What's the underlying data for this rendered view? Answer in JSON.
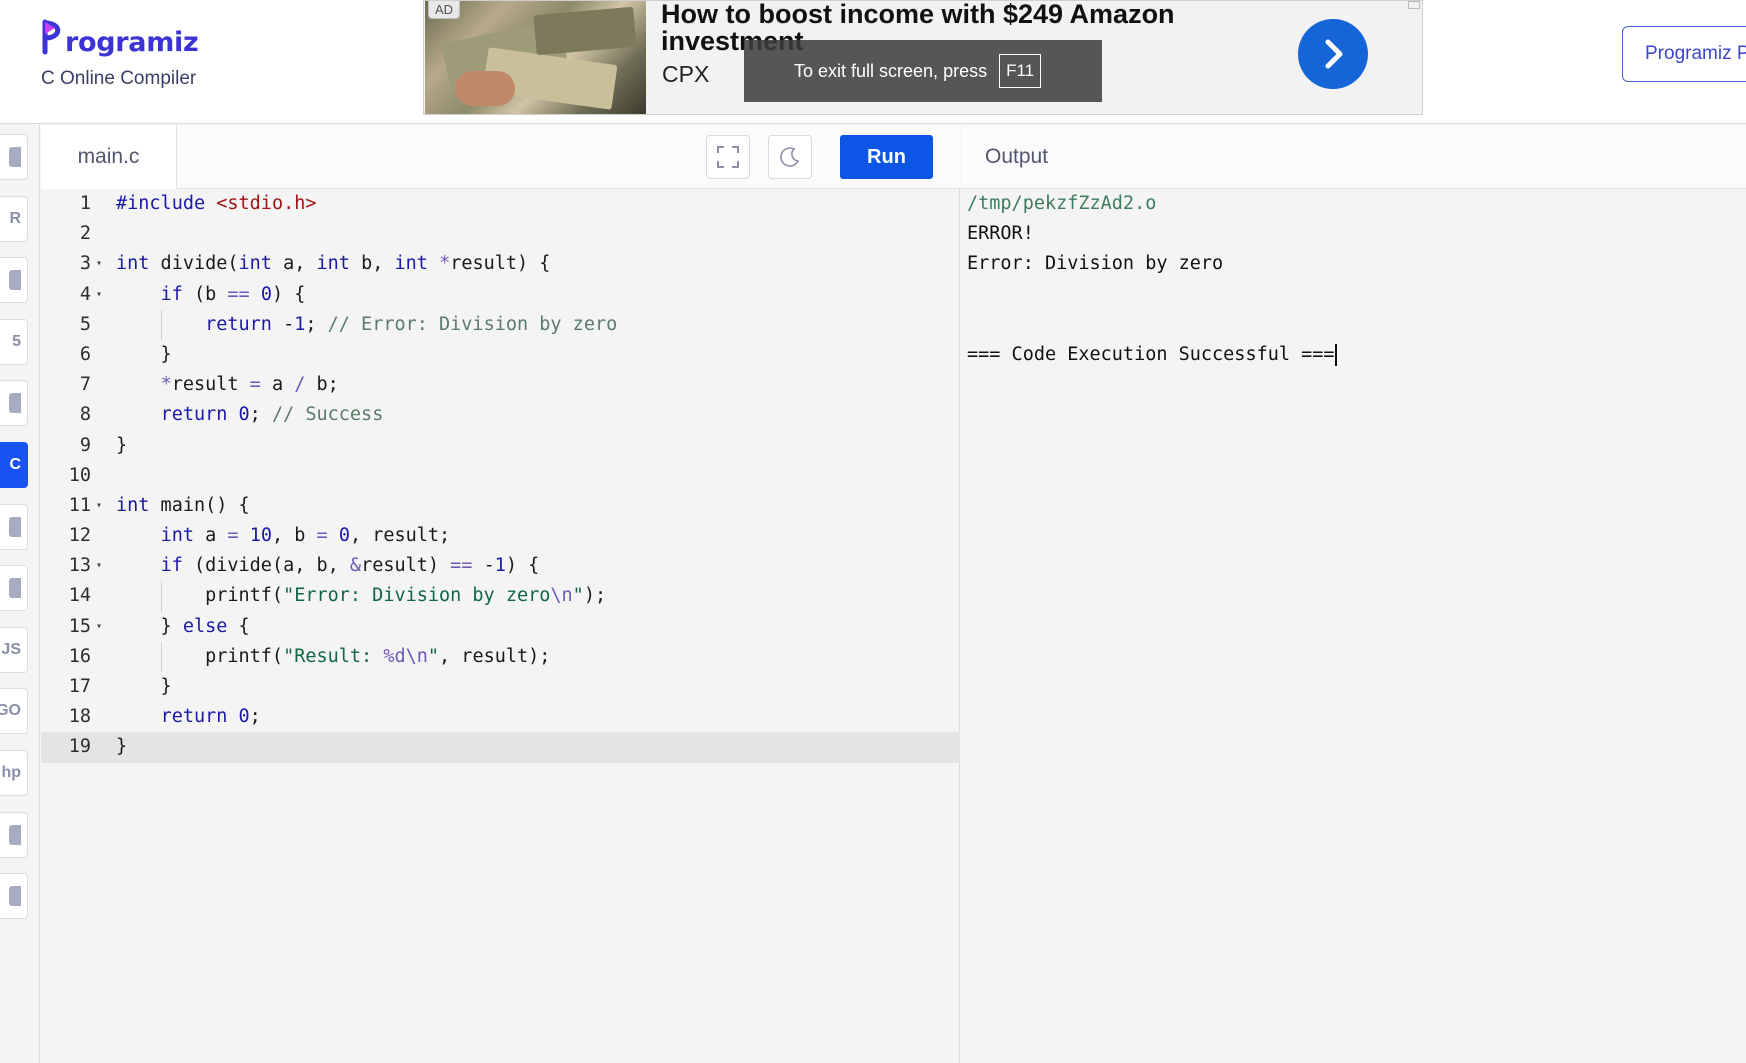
{
  "header": {
    "logo_text": "rogramiz",
    "subtitle": "C Online Compiler",
    "right_button_label": "Programiz PRO"
  },
  "ad": {
    "badge": "AD",
    "title": "How to boost income with $249 Amazon investment",
    "brand": "CPX"
  },
  "fullscreen_notice": {
    "text": "To exit full screen, press",
    "key": "F11"
  },
  "rail": {
    "items": [
      {
        "name": "python",
        "glyph": "",
        "active": false
      },
      {
        "name": "r",
        "glyph": "R",
        "active": false
      },
      {
        "name": "sql",
        "glyph": "",
        "active": false
      },
      {
        "name": "html",
        "glyph": "5",
        "active": false
      },
      {
        "name": "java",
        "glyph": "",
        "active": false
      },
      {
        "name": "c",
        "glyph": "C",
        "active": true
      },
      {
        "name": "cpp",
        "glyph": "",
        "active": false
      },
      {
        "name": "csharp",
        "glyph": "",
        "active": false
      },
      {
        "name": "js",
        "glyph": "JS",
        "active": false
      },
      {
        "name": "go",
        "glyph": "GO",
        "active": false
      },
      {
        "name": "php",
        "glyph": "hp",
        "active": false
      },
      {
        "name": "swift",
        "glyph": "",
        "active": false
      },
      {
        "name": "rust",
        "glyph": "",
        "active": false
      }
    ]
  },
  "editor": {
    "file_tab": "main.c",
    "run_label": "Run",
    "active_line": 19,
    "lines": [
      "#include <stdio.h>",
      "",
      "int divide(int a, int b, int *result) {",
      "    if (b == 0) {",
      "        return -1; // Error: Division by zero",
      "    }",
      "    *result = a / b;",
      "    return 0; // Success",
      "}",
      "",
      "int main() {",
      "    int a = 10, b = 0, result;",
      "    if (divide(a, b, &result) == -1) {",
      "        printf(\"Error: Division by zero\\n\");",
      "    } else {",
      "        printf(\"Result: %d\\n\", result);",
      "    }",
      "    return 0;",
      "}"
    ],
    "fold_lines": [
      3,
      4,
      11,
      13,
      15
    ]
  },
  "output": {
    "label": "Output",
    "lines": [
      "/tmp/pekzfZzAd2.o",
      "ERROR!",
      "Error: Division by zero",
      "",
      "",
      "=== Code Execution Successful ==="
    ]
  },
  "colors": {
    "run_button": "#0c55e5",
    "active_rail": "#1a53f5",
    "logo": "#3c33d6"
  }
}
